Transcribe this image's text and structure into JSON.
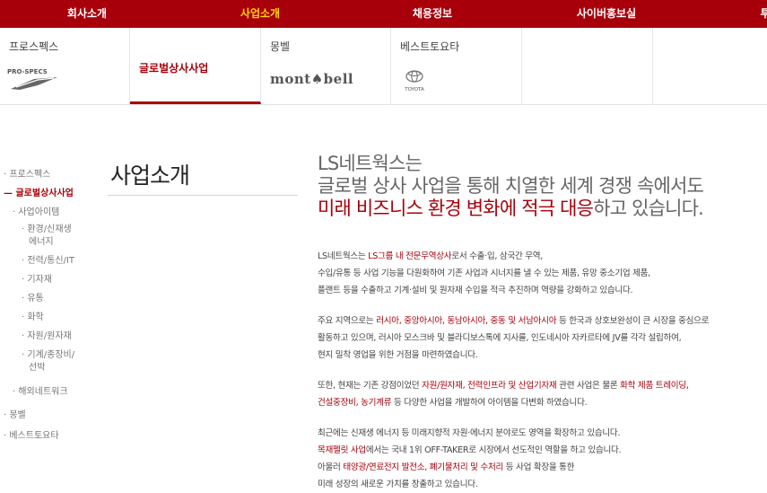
{
  "top_nav": {
    "items": [
      {
        "label": "회사소개",
        "active": false
      },
      {
        "label": "사업소개",
        "active": true
      },
      {
        "label": "채용정보",
        "active": false
      },
      {
        "label": "사이버홍보실",
        "active": false
      },
      {
        "label": "투",
        "active": false
      }
    ],
    "bg_color": "#a8000a",
    "active_color": "#ffd200"
  },
  "sub_menu": {
    "items": [
      {
        "label": "프로스펙스",
        "logo_text": "PRO-SPECS"
      },
      {
        "label": "글로벌상사사업",
        "active": true
      },
      {
        "label": "몽벨",
        "logo_text": "mont♠bell"
      },
      {
        "label": "베스트토요타",
        "logo_text": "TOYOTA"
      },
      {
        "label": ""
      }
    ]
  },
  "left_nav": {
    "items": [
      {
        "label": "· 프로스펙스"
      },
      {
        "label": "— 글로벌상사사업",
        "active": true
      },
      {
        "label": "· 사업아이템"
      },
      {
        "label": "· 환경/신재생"
      },
      {
        "label": "에너지"
      },
      {
        "label": "· 전력/통신/IT"
      },
      {
        "label": "· 기자재"
      },
      {
        "label": "· 유통"
      },
      {
        "label": "· 화학"
      },
      {
        "label": "· 자원/원자재"
      },
      {
        "label": "· 기계/종장비/"
      },
      {
        "label": "선박"
      },
      {
        "label": "· 해외네트워크"
      },
      {
        "label": "· 몽벨"
      },
      {
        "label": "· 베스트토요타"
      }
    ]
  },
  "page_title": "사업소개",
  "headline": {
    "line1": "LS네트웍스는",
    "line2": "글로벌 상사 사업을 통해 치열한 세계 경쟁 속에서도",
    "line3_red": "미래 비즈니스 환경 변화에 적극 대응",
    "line3_rest": "하고 있습니다."
  },
  "paragraphs": {
    "p1": {
      "l1a": "LS네트웍스는 ",
      "l1b": "LS그룹 내 전문무역상사",
      "l1c": "로서 수출·입, 삼국간 무역,",
      "l2": "수입/유통 등 사업 기능을 다원화하여 기존 사업과 시너지를 낼 수 있는 제품, 유망 중소기업 제품,",
      "l3": "플랜트 등을 수출하고 기계·설비 및 원자재 수입을 적극 추진하며 역량을 강화하고 있습니다."
    },
    "p2": {
      "l1a": "주요 지역으로는 ",
      "l1b": "러시아, 중앙아시아, 동남아시아, 중동 및 서남아시아",
      "l1c": " 등 한국과 상호보완성이 큰 시장을 중심으로",
      "l2": "활동하고 있으며, 러시아 모스크바 및 블라디보스톡에 지사를, 인도네시아 자카르타에 JV를 각각 설립하여,",
      "l3": "현지 밀착 영업을 위한 거점을 마련하였습니다."
    },
    "p3": {
      "l1a": "또한, 현재는 기존 강점이었던 ",
      "l1b": "자원/원자재, 전력인프라 및 산업기자재",
      "l1c": " 관련 사업은 물론 ",
      "l1d": "화학 제품 트레이딩,",
      "l2a": "건설중장비, 농기계류",
      "l2b": " 등 다양한 사업을 개발하여 아이템을 다변화 하였습니다."
    },
    "p4": {
      "l1": "최근에는 신재생 에너지 등 미래지향적 자원·에너지 분야로도 영역을 확장하고 있습니다.",
      "l2a": "목재펠릿 사업",
      "l2b": "에서는 국내 1위 OFF-TAKER로 시장에서 선도적인 역할을 하고 있습니다.",
      "l3a": "아울러 ",
      "l3b": "태양광/연료전지 발전소, 폐기물처리 및 수처리",
      "l3c": " 등 사업 확장을 통한",
      "l4": "미래 성장의 새로운 가치를 창출하고 있습니다."
    }
  }
}
